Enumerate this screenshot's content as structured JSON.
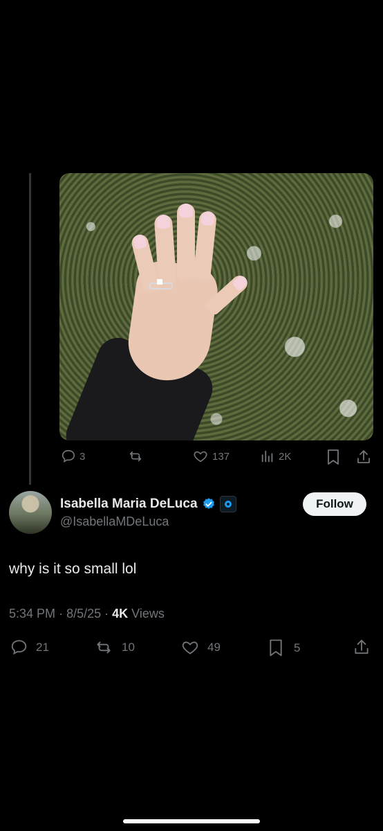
{
  "quoted": {
    "actions": {
      "replies": "3",
      "reposts": "",
      "likes": "137",
      "views": "2K"
    }
  },
  "tweet": {
    "author_name": "Isabella Maria DeLuca",
    "author_handle": "@IsabellaMDeLuca",
    "follow_label": "Follow",
    "text": "why is it so small lol",
    "time": "5:34 PM",
    "date": "8/5/25",
    "views_count": "4K",
    "views_label": "Views",
    "actions": {
      "replies": "21",
      "reposts": "10",
      "likes": "49",
      "bookmarks": "5"
    }
  },
  "colors": {
    "background": "#000000",
    "text": "#e7e9ea",
    "muted": "#71767b",
    "verified": "#1d9bf0"
  },
  "icons": [
    "reply-icon",
    "repost-icon",
    "like-icon",
    "views-icon",
    "bookmark-icon",
    "share-icon",
    "verified-badge-icon",
    "affiliate-badge-icon"
  ]
}
